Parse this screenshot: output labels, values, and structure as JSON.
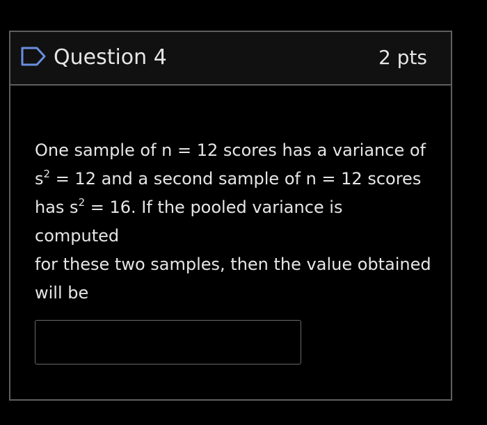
{
  "question": {
    "title": "Question 4",
    "points": "2 pts",
    "flag_icon": "flag-outline-icon",
    "body": {
      "line1": "One sample of n = 12 scores has a variance of",
      "line2_s": "s",
      "line2_exp": "2",
      "line2_rest": " = 12 and a second sample of n = 12 scores",
      "line3_pre": "has s",
      "line3_exp": "2",
      "line3_rest": " = 16. If the pooled variance is computed",
      "line4": "for these two samples, then the value obtained",
      "line5": "will be"
    },
    "answer": {
      "value": "",
      "placeholder": ""
    }
  },
  "colors": {
    "background": "#000000",
    "header_background": "#111111",
    "border": "#5f5f5f",
    "text": "#e6e6e6",
    "flag_icon": "#6a8fe0"
  }
}
